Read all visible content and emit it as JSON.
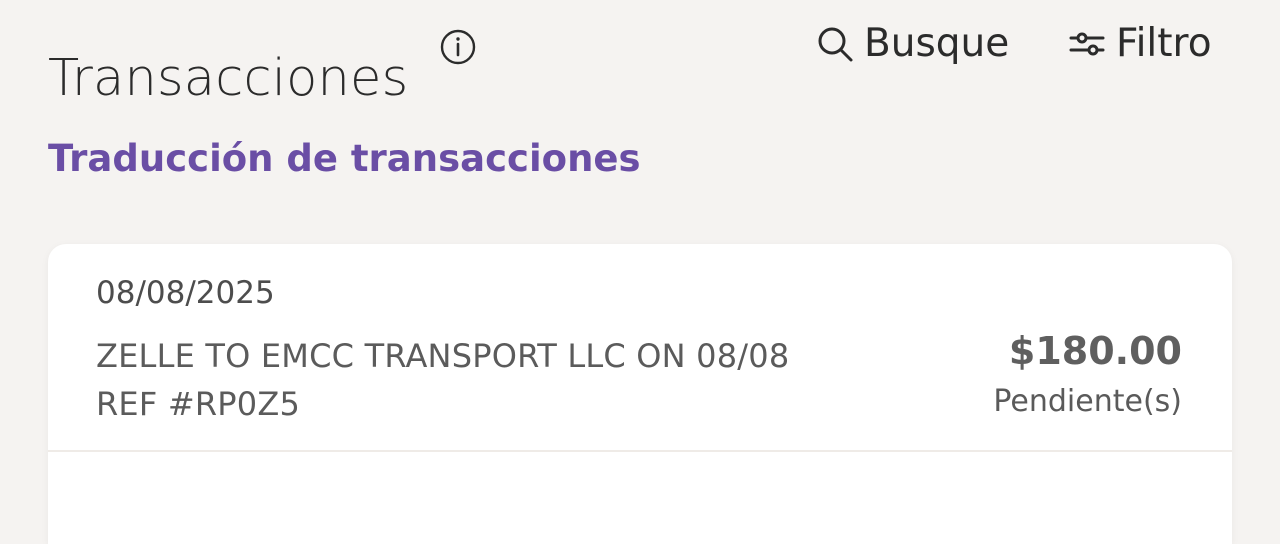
{
  "header": {
    "title": "Transacciones",
    "search_label": "Busque",
    "filter_label": "Filtro"
  },
  "translation": {
    "link_label": "Traducción de transacciones"
  },
  "transactions": [
    {
      "date": "08/08/2025",
      "description_line1": "ZELLE TO EMCC TRANSPORT LLC ON 08/08",
      "description_line2": "REF #RP0Z5",
      "amount": "$180.00",
      "status": "Pendiente(s)"
    }
  ],
  "icons": {
    "info": "info-icon",
    "search": "search-icon",
    "filter": "filter-icon"
  },
  "colors": {
    "background": "#f5f3f1",
    "card": "#ffffff",
    "accent": "#6a4ea5",
    "text": "#2b2b2b",
    "muted_text": "#5b5b5b",
    "divider": "#efebe7"
  }
}
